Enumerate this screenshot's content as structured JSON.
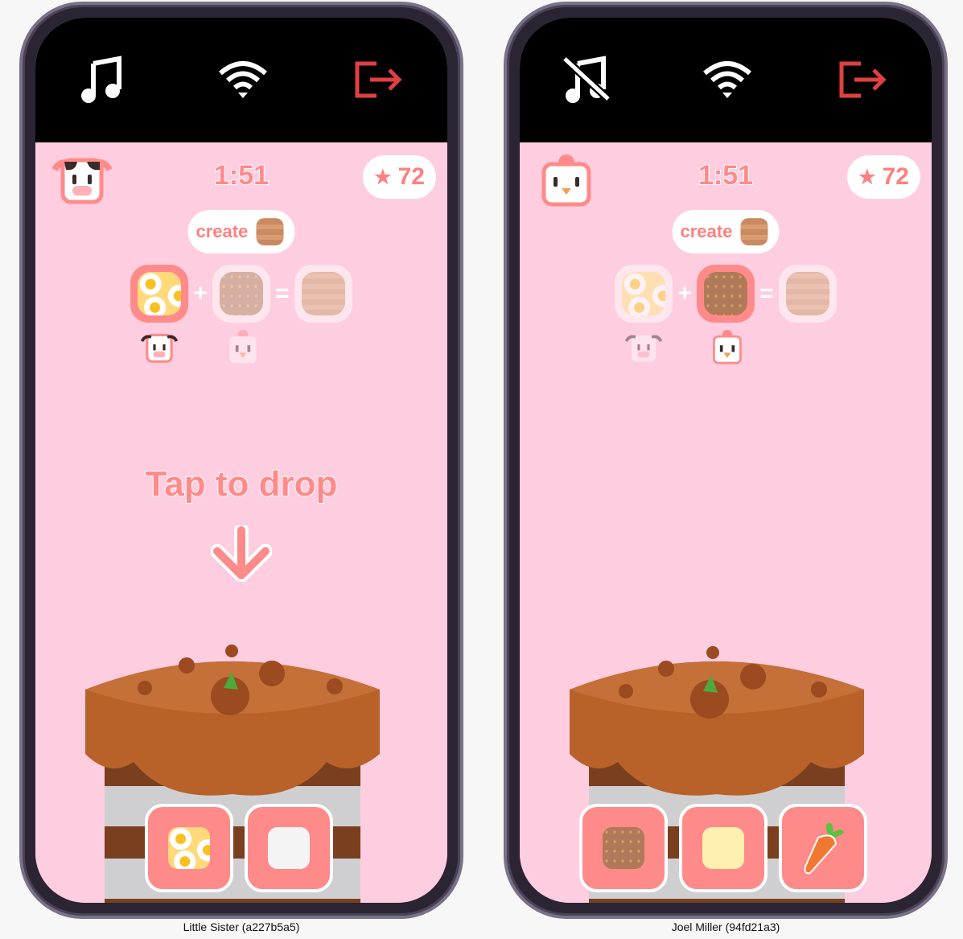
{
  "players": [
    {
      "name": "Little Sister (a227b5a5)",
      "music": "on",
      "avatar": "cow",
      "timer": "1:51",
      "score": "72",
      "create_label": "create",
      "target": "brick",
      "recipe": [
        {
          "item": "egg",
          "state": "active",
          "owner": "cow"
        },
        {
          "item": "grain",
          "state": "faded",
          "owner": "chick"
        },
        {
          "item": "brick",
          "state": "faded"
        }
      ],
      "hint": "Tap to drop",
      "tray": [
        "egg",
        "flour"
      ]
    },
    {
      "name": "Joel Miller (94fd21a3)",
      "music": "muted",
      "avatar": "chick",
      "timer": "1:51",
      "score": "72",
      "create_label": "create",
      "target": "brick",
      "recipe": [
        {
          "item": "egg",
          "state": "faded",
          "owner": "cow"
        },
        {
          "item": "grain",
          "state": "active",
          "owner": "chick"
        },
        {
          "item": "brick",
          "state": "faded"
        }
      ],
      "hint": "",
      "tray": [
        "grain",
        "butter",
        "carrot"
      ]
    }
  ],
  "colors": {
    "accent": "#ff8a8a",
    "background": "#ffcde0",
    "exit": "#e04040"
  }
}
